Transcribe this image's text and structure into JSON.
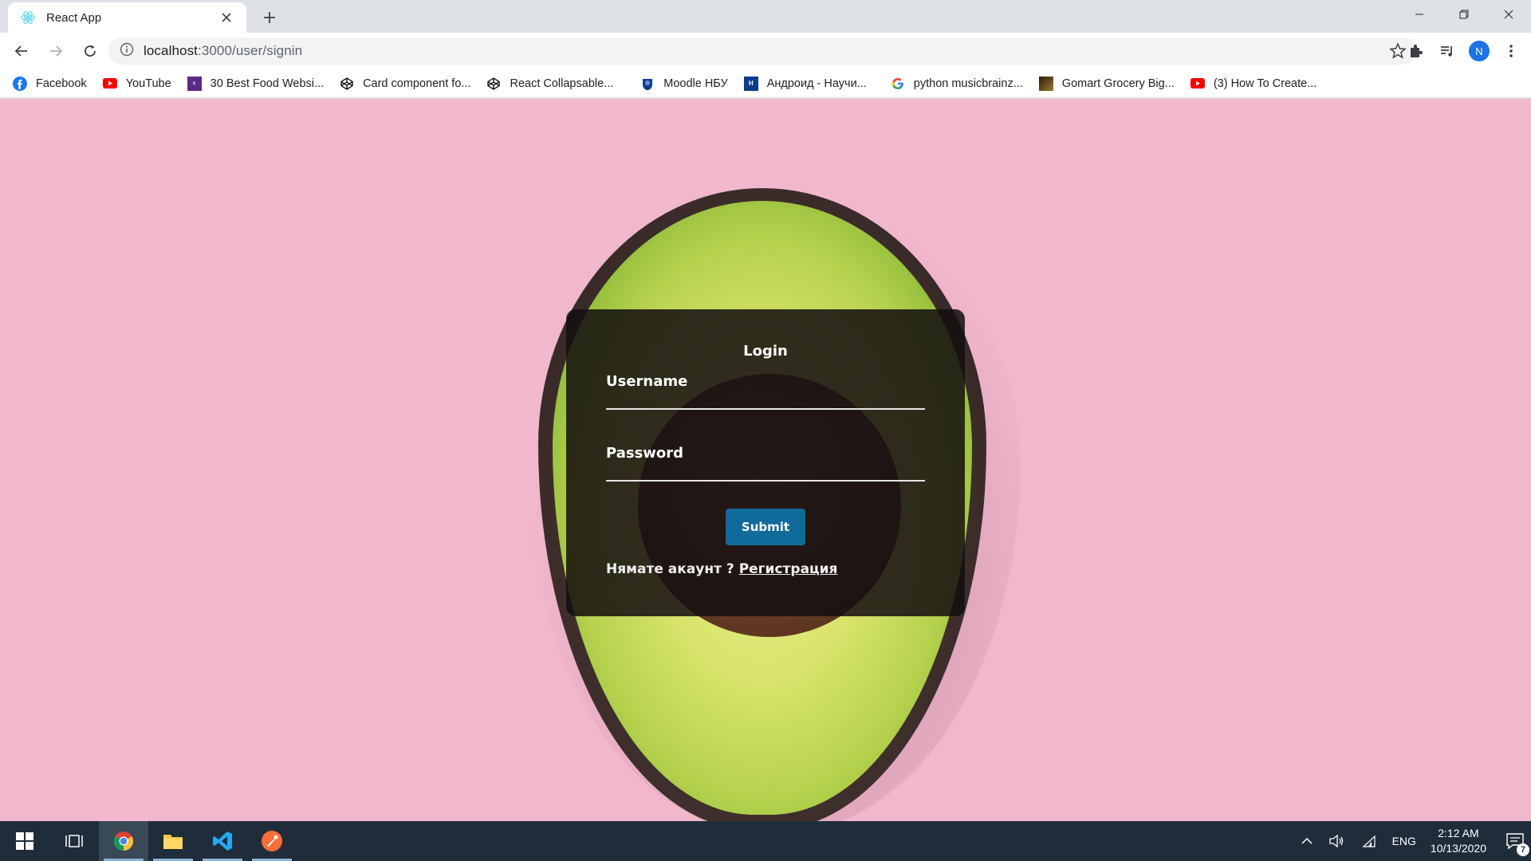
{
  "browser": {
    "tab": {
      "title": "React App"
    },
    "address": {
      "host": "localhost",
      "path": ":3000/user/signin"
    },
    "profile_initial": "N"
  },
  "bookmarks": [
    {
      "label": "Facebook",
      "icon": "facebook-icon",
      "color": "#1877f2"
    },
    {
      "label": "YouTube",
      "icon": "youtube-icon",
      "color": "#ff0000"
    },
    {
      "label": "30 Best Food Websi...",
      "icon": "colorlib-icon",
      "color": "#5b2a86"
    },
    {
      "label": "Card component fo...",
      "icon": "codepen-icon",
      "color": "#000000"
    },
    {
      "label": "React Collapsable...",
      "icon": "codepen-icon",
      "color": "#000000"
    },
    {
      "label": "Moodle НБУ",
      "icon": "moodle-icon",
      "color": "#0f3d91"
    },
    {
      "label": "Андроид - Научи...",
      "icon": "hl-icon",
      "color": "#0c3b8c"
    },
    {
      "label": "python musicbrainz...",
      "icon": "google-icon",
      "color": "#4285f4"
    },
    {
      "label": "Gomart Grocery Big...",
      "icon": "gomart-icon",
      "color": "#6b4a1e"
    },
    {
      "label": "(3) How To Create...",
      "icon": "youtube-icon",
      "color": "#ff0000"
    }
  ],
  "login": {
    "title": "Login",
    "username_label": "Username",
    "password_label": "Password",
    "submit_label": "Submit",
    "no_account_text": "Нямате акаунт ?",
    "register_link": "Регистрация"
  },
  "taskbar": {
    "lang": "ENG",
    "time": "2:12 AM",
    "date": "10/13/2020",
    "notification_count": "7"
  },
  "colors": {
    "page_background": "#f1b7cc",
    "card_background": "rgba(20,14,16,0.86)",
    "submit_button": "#0f6b9a",
    "taskbar": "#1f2d3a"
  }
}
